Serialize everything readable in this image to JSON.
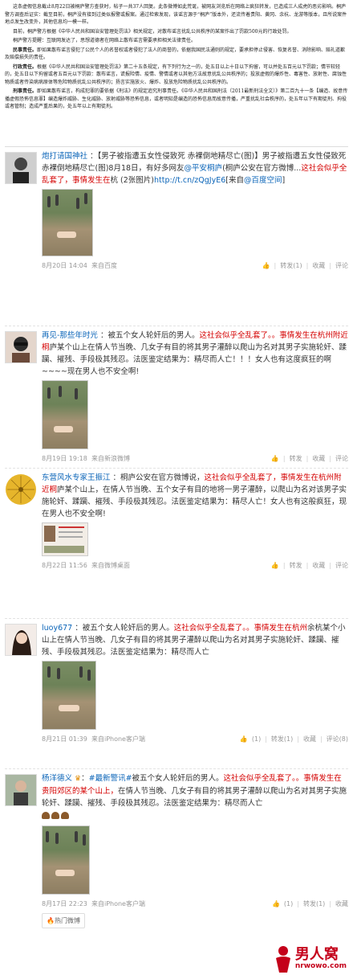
{
  "article": {
    "p1": "这条虚假信息截止8月22日被桐庐警方查获时，帖子一共37人回复。此条微博如此荒诞，被网友浏览后在网络上疯狂转发，已造成三人成虎的恶劣影响。桐庐警方调查后证实：截至目前，桐庐没有接到过类似报警或报案。通过检索发现，该谣言源于“桐庐”版本外，还流传着贵阳、黄冈、余杭、龙游等版本，且所说案件地点发生改变外，其他信息均一模一样。",
    "p2": "目前，桐庐警方根据《中华人民共和国治安管理处罚法》相关规定，对散布谣言扰乱公共秩序的某案作出了罚款500元的行政处罚。",
    "p3": "桐庐警方提醒：互联网发达了，思想道德者在网络上散布谣言需要承担相关法律责任。",
    "civil_label": "民事责任。",
    "civil": "即如果散布谣言侵犯了公民个人的名誉权或者侵犯了法人的商誉的，依据我国民法通则的规定，要承担停止侵害、恢复名誉、消除影响、赔礼道歉及赔偿损失的责任。",
    "admin_label": "行政责任。",
    "admin": "根据《中华人民共和国治安管理处罚法》第二十五条规定，有下列行为之一的，处五日以上十日以下拘留，可以并处五百元以下罚款；情节较轻的，处五日以下拘留或者五百元以下罚款：散布谣言，谎报险情、疫情、警情或者以其他方法故意扰乱公共秩序的；投放虚假的爆炸性、毒害性、放射性、腐蚀性物质或者传染病病原体等危险物质扰乱公共秩序的；扬言实施放火、爆炸、投放危险物质扰乱公共秩序的。",
    "criminal_label": "刑事责任。",
    "criminal": "即如果散布谣言，构成犯罪的要依据《刑法》的规定追究刑事责任。《中华人民共和国刑法（2011最新刑法全文）》第二百九十一条【编造、故意传播虚假恐怖信息罪】编造爆炸威胁、生化威胁、放射威胁等恐怖信息，或者明知是编造的恐怖信息而故意传播，严重扰乱社会秩序的，处五年以下有期徒刑、拘役或者管制；造成严重后果的，处五年以上有期徒刑。"
  },
  "posts": [
    {
      "user": "炮打请国神社",
      "text_a": "：【男子被指遭五女性侵致死 赤裸倒地精尽亡(图)】男子被指遭五女性侵致死 赤裸倒地精尽亡(图)8月18日，有好多网友",
      "link1": "@平安桐庐",
      "text_b": "(桐庐公安在官方微博...",
      "hl": "这社会似乎全乱套了，事情发生在",
      "text_c": "杭 (2张图片)",
      "link2": "http://t.cn/zQgJyE6",
      "text_d": "[来自",
      "link3": "@百度空间",
      "text_e": "]",
      "time": "8月20日 14:04",
      "source": "来自百度",
      "forward": "转发(1)",
      "fav": "收藏",
      "comment": "评论"
    },
    {
      "user": "再见-那些年时光",
      "text_a": "：被五个女人轮奸后的男人。",
      "hl": "这社会似乎全乱套了。。事情发生在杭州附近桐",
      "text_b": "庐某个山上在情人节当晚、几女子有目的将其男子灌醉以爬山为名对其男子实施轮奸、蹂躏、摧残、手段极其残忍。法医鉴定结果为：精尽而人亡！！！女人也有这度疯狂的啊~~~~现在男人也不安全啊!",
      "time": "8月19日 19:18",
      "source": "来自新浪微博",
      "forward": "转发",
      "fav": "收藏",
      "comment": "评论"
    },
    {
      "user": "东营风水专家王振江",
      "text_a": "：桐庐公安在官方微博说，",
      "hl": "这社会似乎全乱套了，事情发生在杭州附近桐",
      "text_b": "庐某个山上，在情人节当晚、五个女子有目的地将一男子灌醉，以爬山为名对该男子实施轮奸、蹂躏、摧残、手段极其残忍。法医鉴定结果为：精尽人亡！女人也有这般疯狂，现在男人也不安全啊!",
      "time": "8月22日 11:56",
      "source": "来自微博桌面",
      "forward": "转发",
      "fav": "收藏",
      "comment": "评论"
    },
    {
      "user": "luoy677",
      "text_a": "：被五个女人轮奸后的男人。",
      "hl": "这社会似乎全乱套了。。事情发生在杭州",
      "text_b": "余杭某个小山上在情人节当晚、几女子有目的将其男子灌醉以爬山为名对其男子实施轮奸、蹂躏、摧残、手段极其残忍。法医鉴定结果为：精尽而人亡",
      "time": "8月21日 01:39",
      "source": "来自iPhone客户端",
      "like": "(1)",
      "forward": "转发(1)",
      "fav": "收藏",
      "comment": "评论(8)"
    },
    {
      "user": "杨洋德义",
      "text_a": "：",
      "tag": "#最新警讯#",
      "text_b": "被五个女人轮奸后的男人。",
      "hl": "这社会似乎全乱套了。。事情发生在贵阳郊区的某个山上，",
      "text_c": "在情人节当晚、几女子有目的将其男子灌醉以爬山为名对其男子实施轮奸、蹂躏、摧残、手段极其残忍。法医鉴定结果为：精尽而人亡",
      "time": "8月17日 22:23",
      "source": "来自iPhone客户端",
      "like": "(1)",
      "forward": "转发(1)",
      "fav": "收藏",
      "comment": "评论",
      "hot": "热门微博"
    }
  ],
  "logo": {
    "name": "男人窝",
    "url": "nrwowo.com"
  },
  "colors": {
    "link": "#0a64b8",
    "highlight": "#d40000",
    "logo": "#c4001a"
  }
}
